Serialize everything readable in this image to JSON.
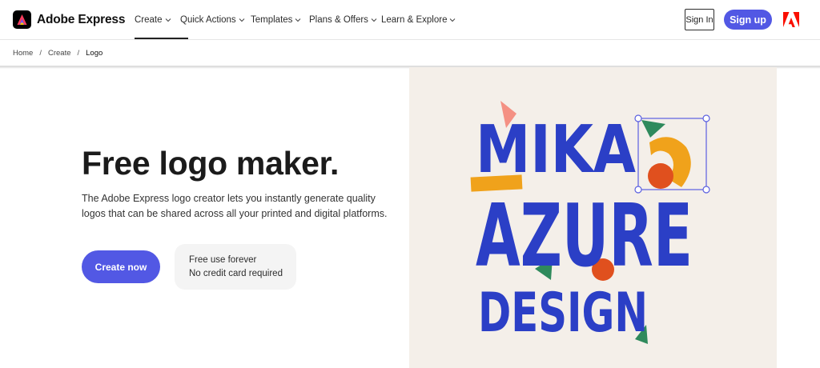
{
  "brand": {
    "name": "Adobe Express",
    "icon": "adobe-express-logo-icon"
  },
  "nav": {
    "items": [
      {
        "label": "Create",
        "icon": "chevron-down-icon"
      },
      {
        "label": "Quick Actions",
        "icon": "chevron-down-icon"
      },
      {
        "label": "Templates",
        "icon": "chevron-down-icon"
      },
      {
        "label": "Plans & Offers",
        "icon": "chevron-down-icon"
      },
      {
        "label": "Learn & Explore",
        "icon": "chevron-down-icon"
      }
    ],
    "sign_in": "Sign In",
    "sign_up": "Sign up",
    "adobe_icon": "adobe-logo-icon"
  },
  "breadcrumb": {
    "items": [
      "Home",
      "Create",
      "Logo"
    ],
    "separator": "/"
  },
  "hero": {
    "title": "Free logo maker.",
    "description": "The Adobe Express logo creator lets you instantly generate quality logos that can be shared across all your printed and digital platforms.",
    "cta": "Create now",
    "info_lines": [
      "Free use forever",
      "No credit card required"
    ]
  },
  "artwork": {
    "lines": [
      "MIKA",
      "AZURE",
      "DESIGN"
    ],
    "colors": {
      "letters": "#2b3fc6",
      "orange": "#f0a21b",
      "red": "#e0501e",
      "green": "#2f8a5c",
      "pink": "#f49083",
      "selection": "#5a5fe0",
      "background": "#f4efe9"
    }
  },
  "colors": {
    "accent": "#5258e4",
    "text": "#1b1b1b"
  }
}
